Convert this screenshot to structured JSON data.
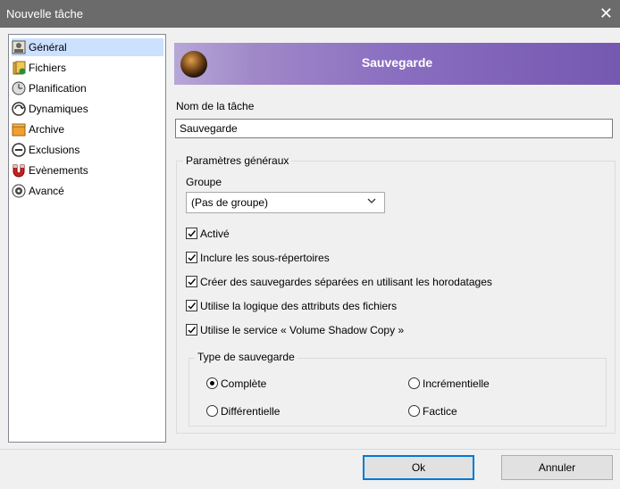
{
  "window": {
    "title": "Nouvelle tâche",
    "close_symbol": "✕"
  },
  "sidebar": {
    "items": [
      {
        "label": "Général",
        "icon": "general-icon",
        "selected": true
      },
      {
        "label": "Fichiers",
        "icon": "files-icon"
      },
      {
        "label": "Planification",
        "icon": "clock-icon"
      },
      {
        "label": "Dynamiques",
        "icon": "dynamic-icon"
      },
      {
        "label": "Archive",
        "icon": "archive-icon"
      },
      {
        "label": "Exclusions",
        "icon": "exclusion-icon"
      },
      {
        "label": "Evènements",
        "icon": "magnet-icon"
      },
      {
        "label": "Avancé",
        "icon": "gear-icon"
      }
    ]
  },
  "banner": {
    "title": "Sauvegarde"
  },
  "task": {
    "name_label": "Nom de la tâche",
    "name_value": "Sauvegarde"
  },
  "general": {
    "legend": "Paramètres généraux",
    "group_label": "Groupe",
    "group_value": "(Pas de groupe)",
    "checkboxes": [
      {
        "label": "Activé",
        "checked": true
      },
      {
        "label": "Inclure les sous-répertoires",
        "checked": true
      },
      {
        "label": "Créer des sauvegardes séparées en utilisant les horodatages",
        "checked": true
      },
      {
        "label": "Utilise la logique des attributs des fichiers",
        "checked": true
      },
      {
        "label": "Utilise le service « Volume Shadow Copy »",
        "checked": true
      }
    ]
  },
  "backup_type": {
    "legend": "Type de sauvegarde",
    "options": [
      {
        "label": "Complète",
        "selected": true
      },
      {
        "label": "Incrémentielle",
        "selected": false
      },
      {
        "label": "Différentielle",
        "selected": false
      },
      {
        "label": "Factice",
        "selected": false
      }
    ]
  },
  "buttons": {
    "ok": "Ok",
    "cancel": "Annuler"
  }
}
